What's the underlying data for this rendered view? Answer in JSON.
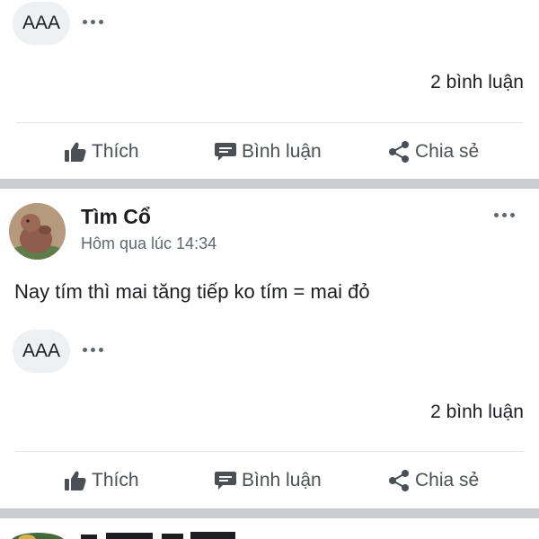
{
  "post1": {
    "reaction_pill": "AAA",
    "comments_count": "2 bình luận",
    "actions": {
      "like": "Thích",
      "comment": "Bình luận",
      "share": "Chia sẻ"
    }
  },
  "post2": {
    "author": "Tìm Cổ",
    "timestamp": "Hôm qua lúc 14:34",
    "text": "Nay tím thì mai tăng tiếp ko tím = mai đỏ",
    "reaction_pill": "AAA",
    "comments_count": "2 bình luận",
    "actions": {
      "like": "Thích",
      "comment": "Bình luận",
      "share": "Chia sẻ"
    }
  },
  "colors": {
    "separator": "#c9ccd1",
    "pill_background": "#eef0f2",
    "action_text": "#4b4f56",
    "meta_text": "#606770"
  },
  "icons": [
    "thumbs-up-icon",
    "comment-icon",
    "share-icon",
    "more-options-icon"
  ]
}
